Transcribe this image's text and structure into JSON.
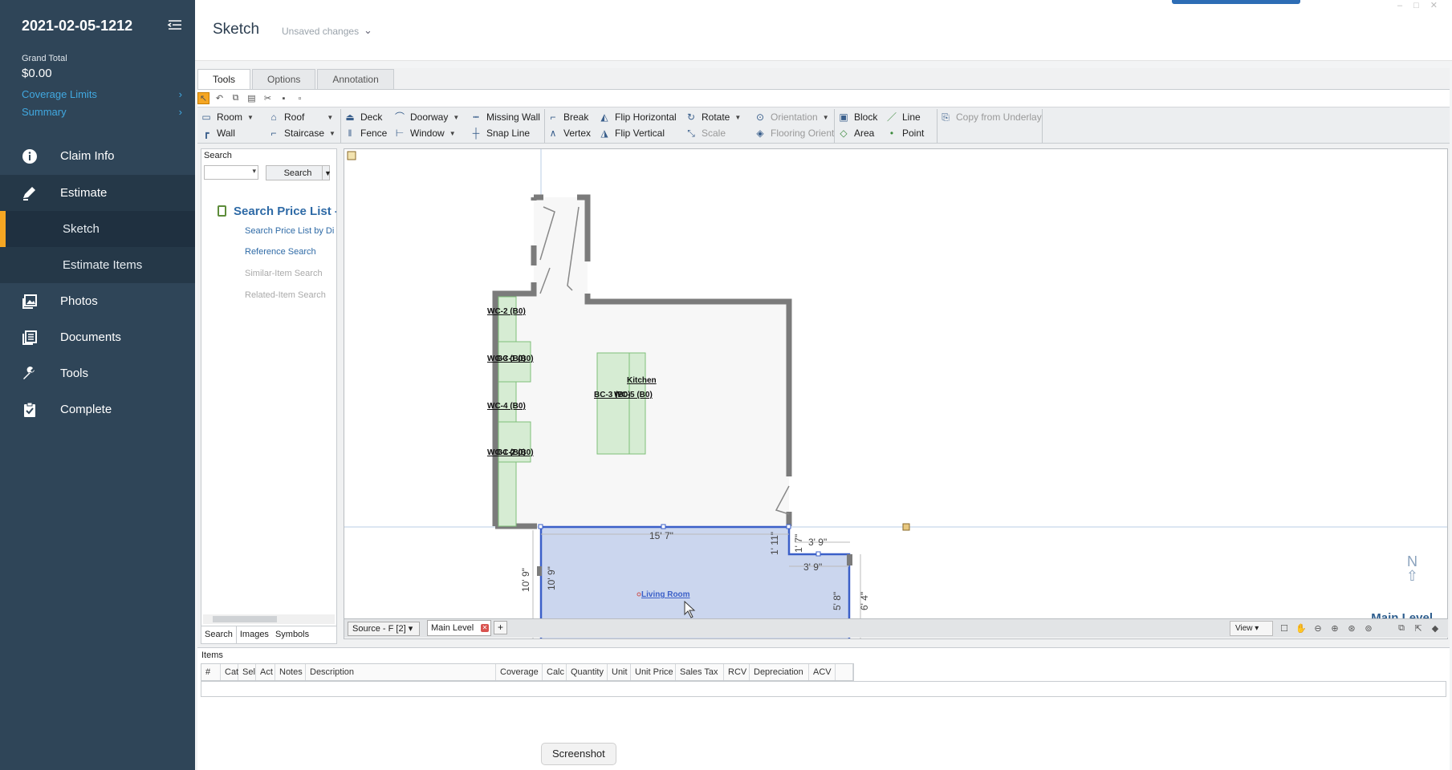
{
  "sidebar": {
    "claim_id": "2021-02-05-1212",
    "grand_total_label": "Grand Total",
    "grand_total_value": "$0.00",
    "coverage_limits": "Coverage Limits",
    "summary": "Summary",
    "nav": {
      "claim_info": "Claim Info",
      "estimate": "Estimate",
      "sketch": "Sketch",
      "estimate_items": "Estimate Items",
      "photos": "Photos",
      "documents": "Documents",
      "tools": "Tools",
      "complete": "Complete"
    },
    "accent": "#f5a623"
  },
  "header": {
    "title": "Sketch",
    "status": "Unsaved changes"
  },
  "tabs": [
    "Tools",
    "Options",
    "Annotation"
  ],
  "toolbar": {
    "room": "Room",
    "wall": "Wall",
    "roof": "Roof",
    "staircase": "Staircase",
    "deck": "Deck",
    "fence": "Fence",
    "doorway": "Doorway",
    "window": "Window",
    "missing_wall": "Missing Wall",
    "snap_line": "Snap Line",
    "break": "Break",
    "vertex": "Vertex",
    "flip_horizontal": "Flip Horizontal",
    "flip_vertical": "Flip Vertical",
    "rotate": "Rotate",
    "scale": "Scale",
    "orientation": "Orientation",
    "flooring_orient": "Flooring Orient",
    "block": "Block",
    "area": "Area",
    "line": "Line",
    "point": "Point",
    "copy_from_underlay": "Copy from Underlay"
  },
  "search_panel": {
    "title": "Search",
    "button": "Search",
    "price_list_title": "Search Price List - ",
    "links": [
      "Search Price List by Di",
      "Reference Search",
      "Similar-Item Search",
      "Related-Item Search"
    ],
    "bottom_tabs": [
      "Search",
      "Images",
      "Symbols"
    ]
  },
  "canvas": {
    "labels": {
      "wc2": "WC-2 (B0)",
      "wc3": "WC-3 (B0)",
      "bc1": "BC-1 (B0)",
      "wc4": "WC-4 (B0)",
      "wc1": "WC-1 (B0)",
      "bc2": "BC-2 (B0)",
      "kitchen": "Kitchen",
      "bc3": "BC-3 (B0)",
      "wc5": "WC-5 (B0)",
      "living_room": "Living Room"
    },
    "dims": {
      "top": "15' 7\"",
      "right_small": "1' 11\"",
      "r2": "1' 7\"",
      "r3": "3' 9\"",
      "r4": "3' 9\"",
      "left": "10' 9\"",
      "left_inner": "10' 9\"",
      "r5": "5' 8\"",
      "r6": "6' 4\""
    },
    "compass": "N",
    "level_name": "Main Level",
    "source_select": "Source - F [2]",
    "level_tab": "Main Level",
    "add_tab": "+",
    "view": "View"
  },
  "items": {
    "title": "Items",
    "columns": [
      "#",
      "Cat",
      "Sel",
      "Act",
      "Notes",
      "Description",
      "Coverage",
      "Calc",
      "Quantity",
      "Unit",
      "Unit Price",
      "Sales Tax",
      "RCV",
      "Depreciation",
      "ACV",
      ""
    ]
  },
  "tooltip": "Screenshot"
}
